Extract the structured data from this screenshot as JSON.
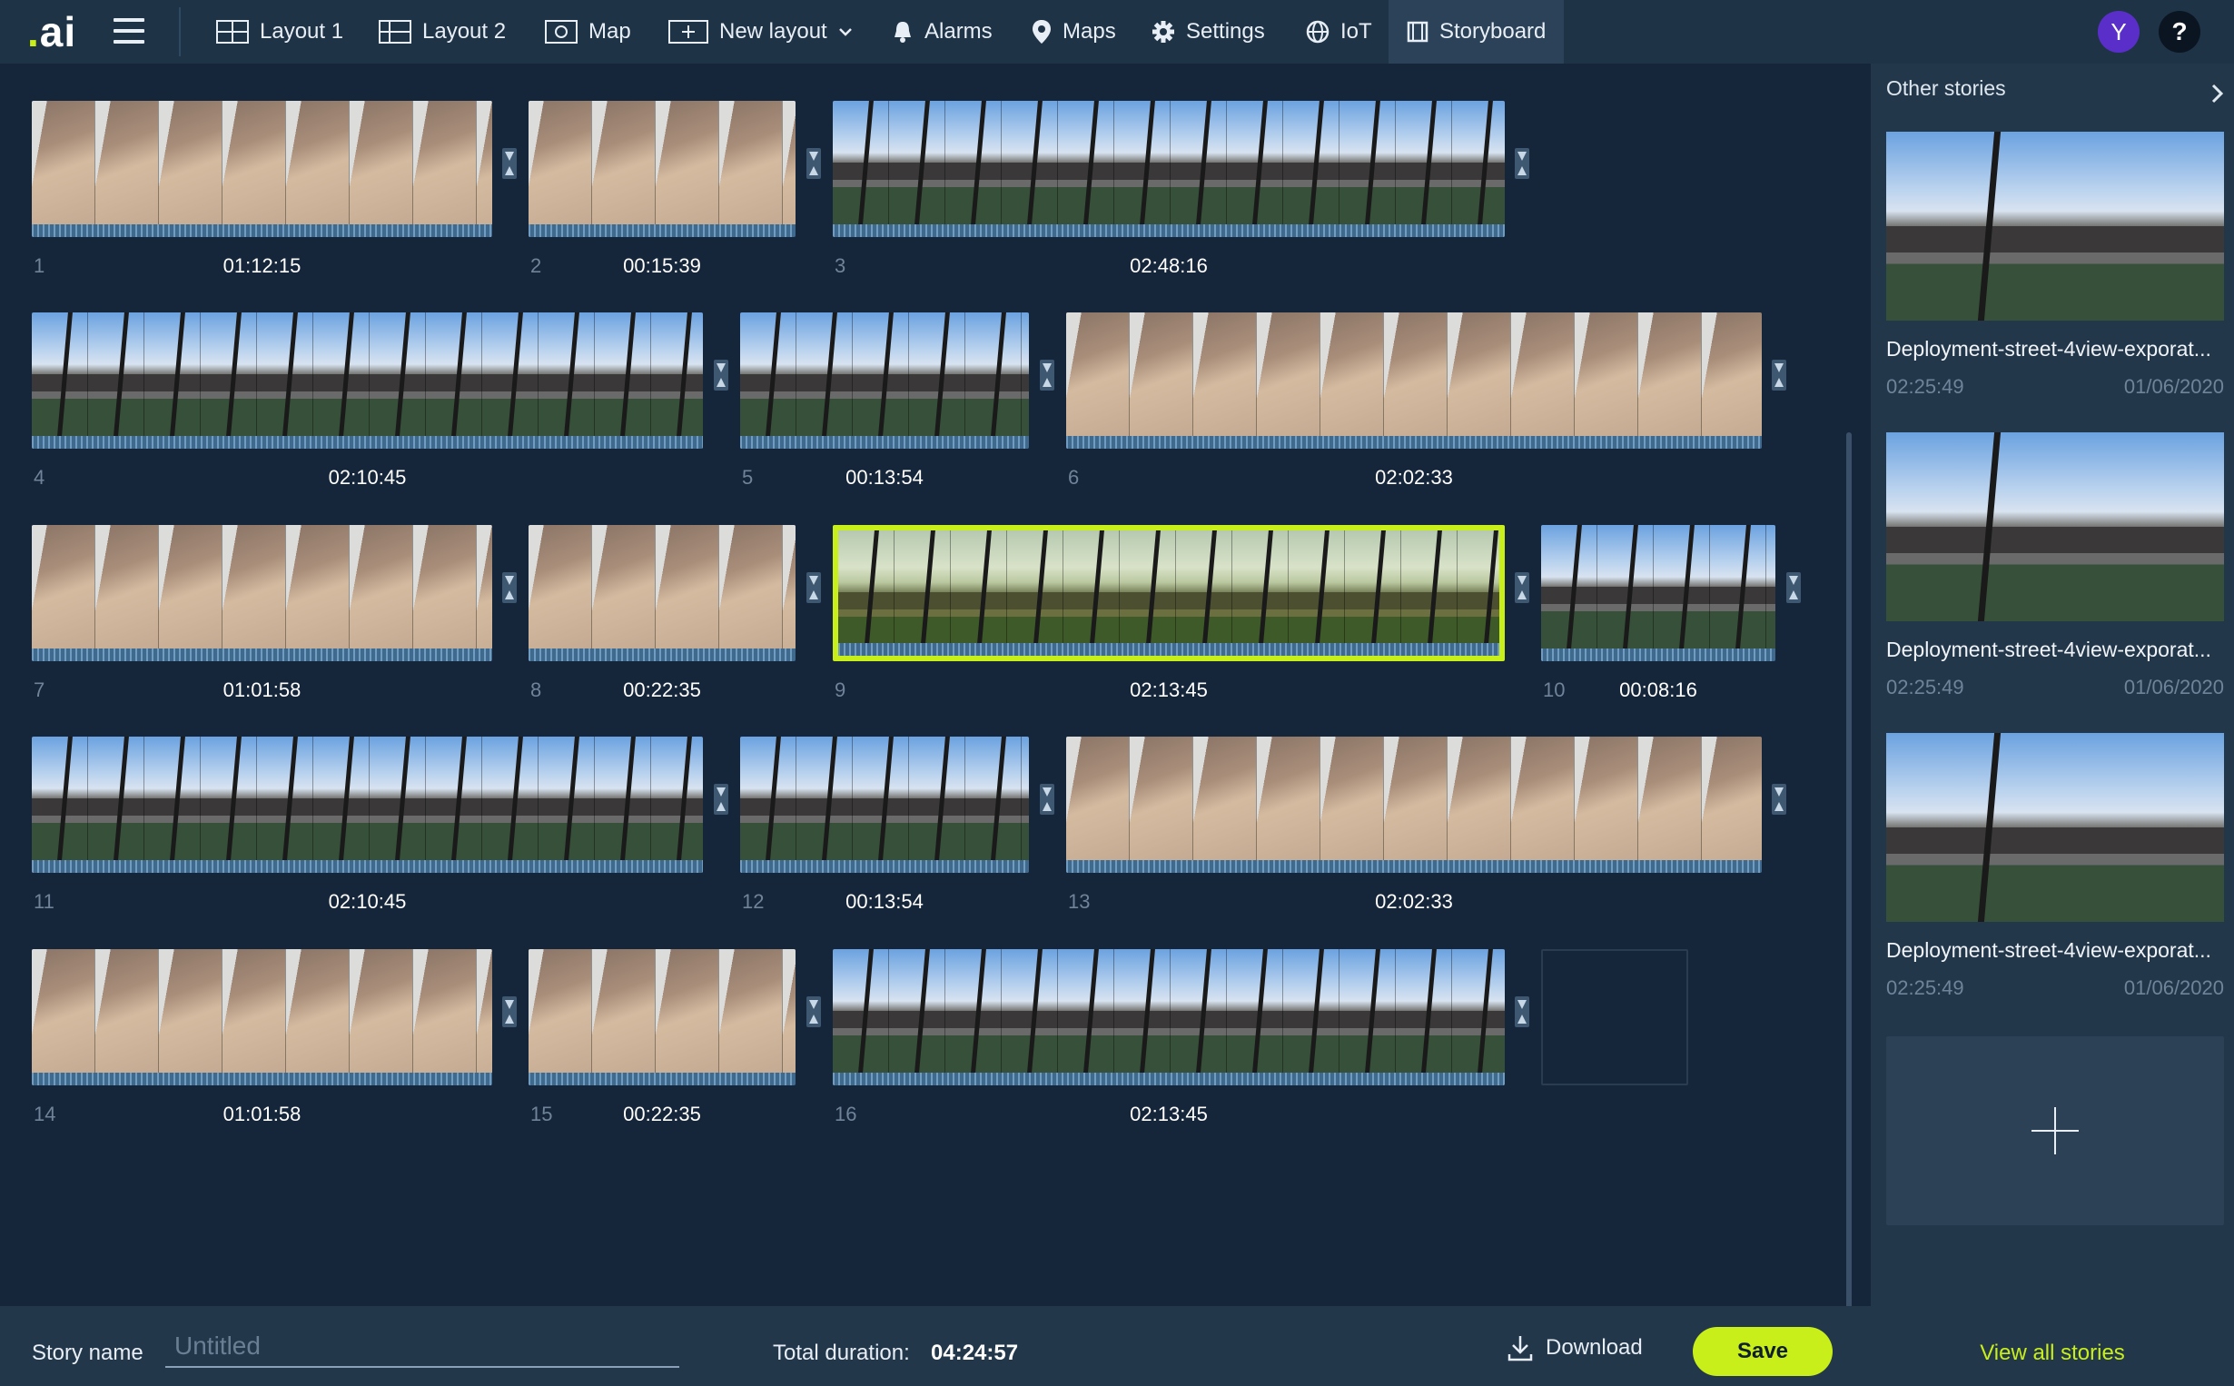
{
  "logo": {
    "dot": ".",
    "text": "ai"
  },
  "nav": {
    "items": [
      {
        "label": "Layout 1",
        "icon": "grid-layout-icon"
      },
      {
        "label": "Layout 2",
        "icon": "grid-layout-icon"
      },
      {
        "label": "Map",
        "icon": "map-frame-icon"
      },
      {
        "label": "New layout",
        "icon": "add-layout-icon"
      },
      {
        "label": "Alarms",
        "icon": "bell-icon"
      },
      {
        "label": "Maps",
        "icon": "location-pin-icon"
      },
      {
        "label": "Settings",
        "icon": "gear-icon"
      },
      {
        "label": "IoT",
        "icon": "globe-icon"
      },
      {
        "label": "Storyboard",
        "icon": "film-icon",
        "active": true
      }
    ],
    "avatar": "Y",
    "help": "?"
  },
  "clips": [
    {
      "num": "1",
      "duration": "01:12:15",
      "kind": "sidewalk"
    },
    {
      "num": "2",
      "duration": "00:15:39",
      "kind": "sidewalk"
    },
    {
      "num": "3",
      "duration": "02:48:16",
      "kind": "street"
    },
    {
      "num": "4",
      "duration": "02:10:45",
      "kind": "street"
    },
    {
      "num": "5",
      "duration": "00:13:54",
      "kind": "street"
    },
    {
      "num": "6",
      "duration": "02:02:33",
      "kind": "sidewalk"
    },
    {
      "num": "7",
      "duration": "01:01:58",
      "kind": "sidewalk"
    },
    {
      "num": "8",
      "duration": "00:22:35",
      "kind": "sidewalk"
    },
    {
      "num": "9",
      "duration": "02:13:45",
      "kind": "green",
      "selected": true
    },
    {
      "num": "10",
      "duration": "00:08:16",
      "kind": "street"
    },
    {
      "num": "11",
      "duration": "02:10:45",
      "kind": "street"
    },
    {
      "num": "12",
      "duration": "00:13:54",
      "kind": "street"
    },
    {
      "num": "13",
      "duration": "02:02:33",
      "kind": "sidewalk"
    },
    {
      "num": "14",
      "duration": "01:01:58",
      "kind": "sidewalk"
    },
    {
      "num": "15",
      "duration": "00:22:35",
      "kind": "sidewalk"
    },
    {
      "num": "16",
      "duration": "02:13:45",
      "kind": "street"
    }
  ],
  "bottom": {
    "story_label": "Story name",
    "story_placeholder": "Untitled",
    "total_label": "Total duration:",
    "total_value": "04:24:57",
    "download_label": "Download",
    "save_label": "Save"
  },
  "side": {
    "title": "Other stories",
    "stories": [
      {
        "name": "Deployment-street-4view-exporat...",
        "duration": "02:25:49",
        "date": "01/06/2020"
      },
      {
        "name": "Deployment-street-4view-exporat...",
        "duration": "02:25:49",
        "date": "01/06/2020"
      },
      {
        "name": "Deployment-street-4view-exporat...",
        "duration": "02:25:49",
        "date": "01/06/2020"
      }
    ],
    "view_all": "View all stories"
  },
  "colors": {
    "accent": "#c8ef1a",
    "bg": "#15253a",
    "panel": "#23374b",
    "avatar": "#5a2fc9"
  }
}
